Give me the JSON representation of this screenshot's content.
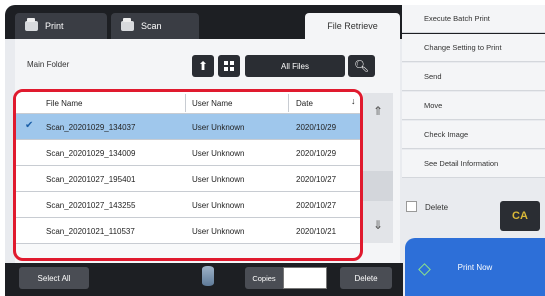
{
  "tabs": {
    "print": "Print",
    "scan": "Scan",
    "file_retrieve": "File Retrieve"
  },
  "collapse_glyph": "▶|",
  "folder": {
    "label": "Main Folder",
    "filter": "All Files"
  },
  "columns": {
    "file_name": "File Name",
    "user_name": "User Name",
    "date": "Date"
  },
  "files": [
    {
      "name": "Scan_20201029_134037",
      "user": "User Unknown",
      "date": "2020/10/29",
      "selected": true
    },
    {
      "name": "Scan_20201029_134009",
      "user": "User Unknown",
      "date": "2020/10/29",
      "selected": false
    },
    {
      "name": "Scan_20201027_195401",
      "user": "User Unknown",
      "date": "2020/10/27",
      "selected": false
    },
    {
      "name": "Scan_20201027_143255",
      "user": "User Unknown",
      "date": "2020/10/27",
      "selected": false
    },
    {
      "name": "Scan_20201021_110537",
      "user": "User Unknown",
      "date": "2020/10/21",
      "selected": false
    }
  ],
  "side_menu": [
    "Execute Batch Print",
    "Change Setting to Print",
    "Send",
    "Move",
    "Check Image",
    "See Detail Information"
  ],
  "delete_option": "Delete",
  "clear_all_label": "CA",
  "print_now": "Print Now",
  "bottom": {
    "select_all": "Select All",
    "copies_label": "Copies",
    "copies_value": "",
    "delete": "Delete"
  },
  "colors": {
    "highlight_frame": "#e01a2e",
    "selected_row": "#9fc7ec",
    "print_now": "#2d6fd8",
    "clear_all_text": "#d9b838"
  }
}
